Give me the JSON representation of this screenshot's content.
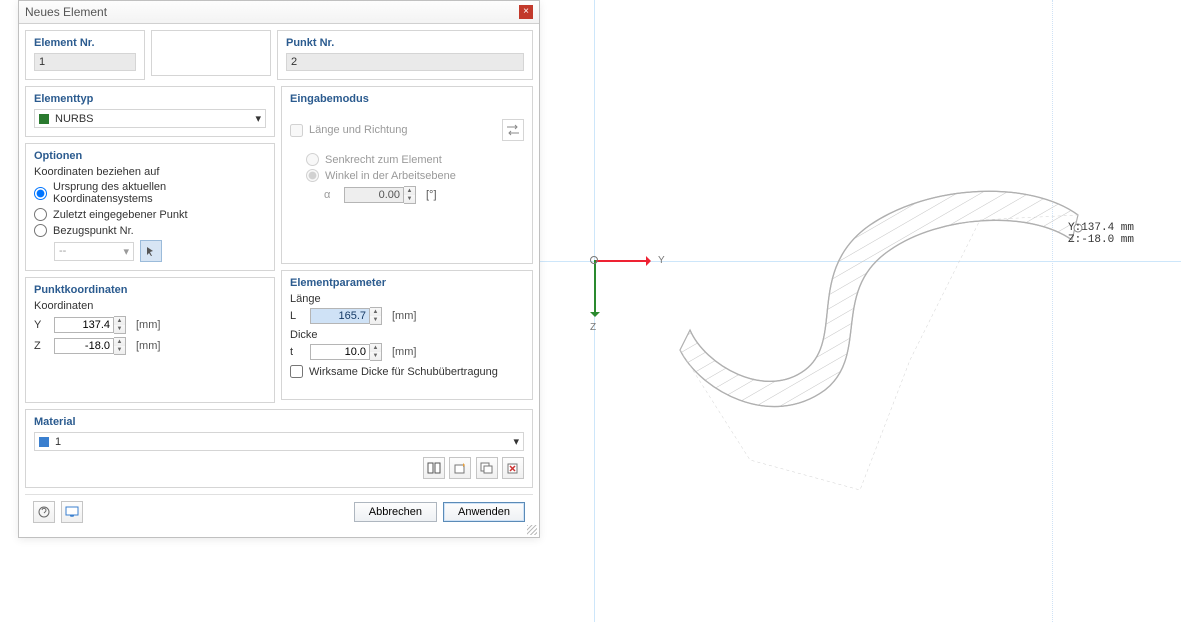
{
  "title": "Neues Element",
  "elementNr": {
    "label": "Element Nr.",
    "value": "1"
  },
  "punktNr": {
    "label": "Punkt Nr.",
    "value": "2"
  },
  "elementtyp": {
    "label": "Elementtyp",
    "value": "NURBS"
  },
  "optionen": {
    "title": "Optionen",
    "subtitle": "Koordinaten beziehen auf",
    "opt1": "Ursprung des aktuellen Koordinatensystems",
    "opt2": "Zuletzt eingegebener Punkt",
    "opt3": "Bezugspunkt Nr.",
    "refValue": "--"
  },
  "eingabemodus": {
    "title": "Eingabemodus",
    "laenge": "Länge und Richtung",
    "senkrecht": "Senkrecht zum Element",
    "winkel": "Winkel in der Arbeitsebene",
    "alphaLabel": "α",
    "alphaValue": "0.00",
    "alphaUnit": "[°]"
  },
  "punktkoordinaten": {
    "title": "Punktkoordinaten",
    "subtitle": "Koordinaten",
    "yLabel": "Y",
    "yValue": "137.4",
    "zLabel": "Z",
    "zValue": "-18.0",
    "unit": "[mm]"
  },
  "elementparameter": {
    "title": "Elementparameter",
    "laengeLabel": "Länge",
    "lLabel": "L",
    "lValue": "165.7",
    "dickeLabel": "Dicke",
    "tLabel": "t",
    "tValue": "10.0",
    "unit": "[mm]",
    "wirksame": "Wirksame Dicke für Schubübertragung"
  },
  "material": {
    "title": "Material",
    "value": "1"
  },
  "buttons": {
    "cancel": "Abbrechen",
    "apply": "Anwenden"
  },
  "canvas": {
    "yAxis": "Y",
    "zAxis": "Z",
    "readout": "Y:137.4 mm\nZ:-18.0 mm"
  }
}
